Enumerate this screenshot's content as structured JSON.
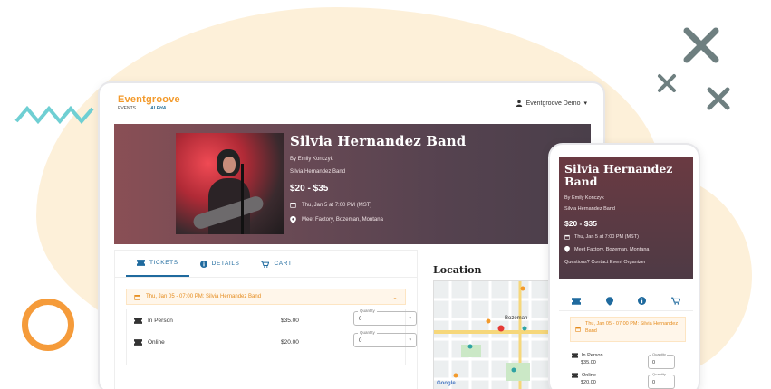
{
  "brand": {
    "name": "Eventgroove",
    "sub_left": "EVENTS",
    "sub_right": "ALPHA"
  },
  "user": {
    "name": "Eventgroove Demo"
  },
  "event": {
    "title": "Silvia Hernandez Band",
    "by": "By Emily Konczyk",
    "performer": "Silvia Hernandez Band",
    "price_range": "$20 - $35",
    "date": "Thu, Jan 5 at 7:00 PM (MST)",
    "venue": "Meet Factory, Bozeman, Montana",
    "questions": "Questions? Contact Event Organizer"
  },
  "tabs": [
    {
      "label": "TICKETS",
      "icon": "ticket-icon"
    },
    {
      "label": "DETAILS",
      "icon": "info-icon"
    },
    {
      "label": "CART",
      "icon": "cart-icon"
    }
  ],
  "date_banner": "Thu, Jan 05 - 07:00 PM: Silvia Hernandez Band",
  "phone_date_banner": "Thu, Jan 05 - 07:00 PM: Silvia Hernandez Band",
  "tickets": [
    {
      "name": "In Person",
      "price": "$35.00",
      "qty_label": "Quantity",
      "qty": "0"
    },
    {
      "name": "Online",
      "price": "$20.00",
      "qty_label": "Quantity",
      "qty": "0"
    }
  ],
  "location_heading": "Location",
  "map_labels": {
    "city": "Bozeman",
    "google": "Google"
  },
  "colors": {
    "accent": "#f39a2b",
    "primary": "#1f6a9e",
    "hero": "#6a4a55"
  }
}
